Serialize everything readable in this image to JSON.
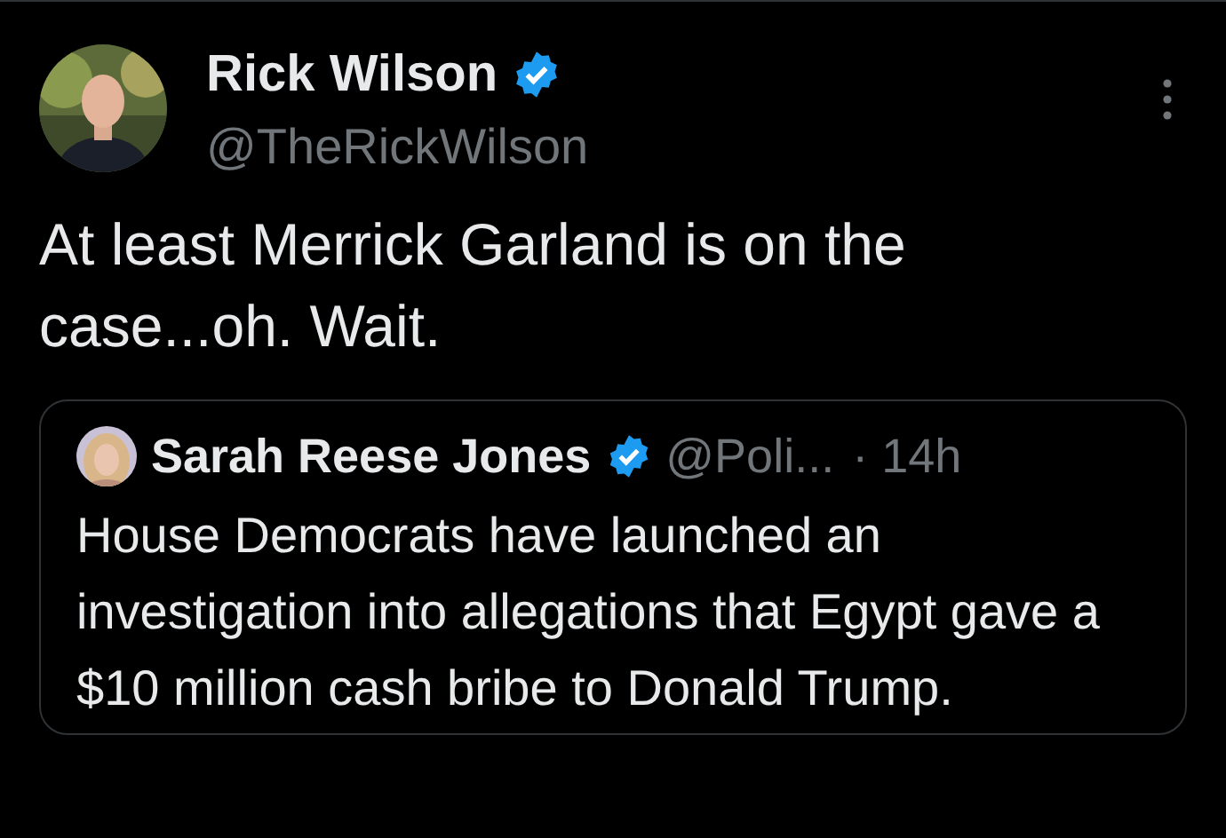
{
  "tweet": {
    "author": {
      "name": "Rick Wilson",
      "verified": true,
      "handle": "@TheRickWilson"
    },
    "text": "At least Merrick Garland is on the case...oh. Wait.",
    "quoted": {
      "author": {
        "name": "Sarah Reese Jones",
        "verified": true,
        "handle": "@Poli...",
        "time": "· 14h"
      },
      "text": "House Democrats have launched an investigation into allegations that Egypt gave a $10 million cash bribe to Donald Trump."
    }
  }
}
